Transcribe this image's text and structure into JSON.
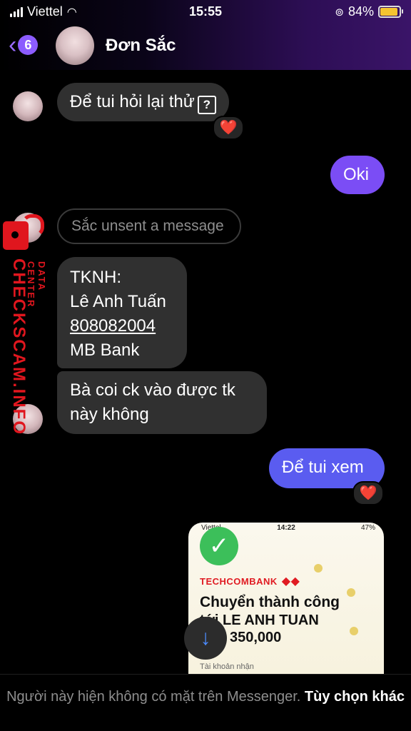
{
  "status": {
    "carrier": "Viettel",
    "time": "15:55",
    "battery": "84%",
    "battery_level": 0.84
  },
  "header": {
    "back_count": "6",
    "contact_name": "Đơn Sắc"
  },
  "messages": [
    {
      "id": "m1",
      "sender": "contact",
      "text": "Để tui hỏi lại thử",
      "reaction": "❤️"
    },
    {
      "id": "m2",
      "sender": "me",
      "text": "Oki"
    },
    {
      "id": "m3",
      "sender": "contact",
      "type": "unsent",
      "text": "Sắc unsent a message"
    },
    {
      "id": "m4",
      "sender": "contact",
      "lines": [
        "TKNH:",
        "Lê Anh Tuấn",
        "808082004",
        "MB Bank"
      ]
    },
    {
      "id": "m5",
      "sender": "contact",
      "lines": [
        "Bà coi ck vào được tk",
        "này không"
      ]
    },
    {
      "id": "m6",
      "sender": "me",
      "text": "Để tui xem",
      "reaction": "❤️"
    }
  ],
  "attachment": {
    "statusbar_carrier": "Viettel",
    "statusbar_time": "14:22",
    "statusbar_battery": "47%",
    "bank": "TECHCOMBANK",
    "headline": "Chuyển thành công",
    "recipient": "tới LE ANH TUAN",
    "amount": "350,000",
    "account_label": "Tài khoản nhận"
  },
  "watermark": {
    "brand": "CHECKSCAM.INFO",
    "sub": "DATA CENTER",
    "color": "#e0161e"
  },
  "footer": {
    "note": "Người này hiện không có mặt trên Messenger.",
    "option": "Tùy chọn khác"
  },
  "colors": {
    "accent": "#8c5cff",
    "my_bubble_purple": "#7b4df5",
    "my_bubble_blue": "#5a5cf0",
    "their_bubble": "#303030",
    "reaction_heart": "#ff3b4f"
  }
}
